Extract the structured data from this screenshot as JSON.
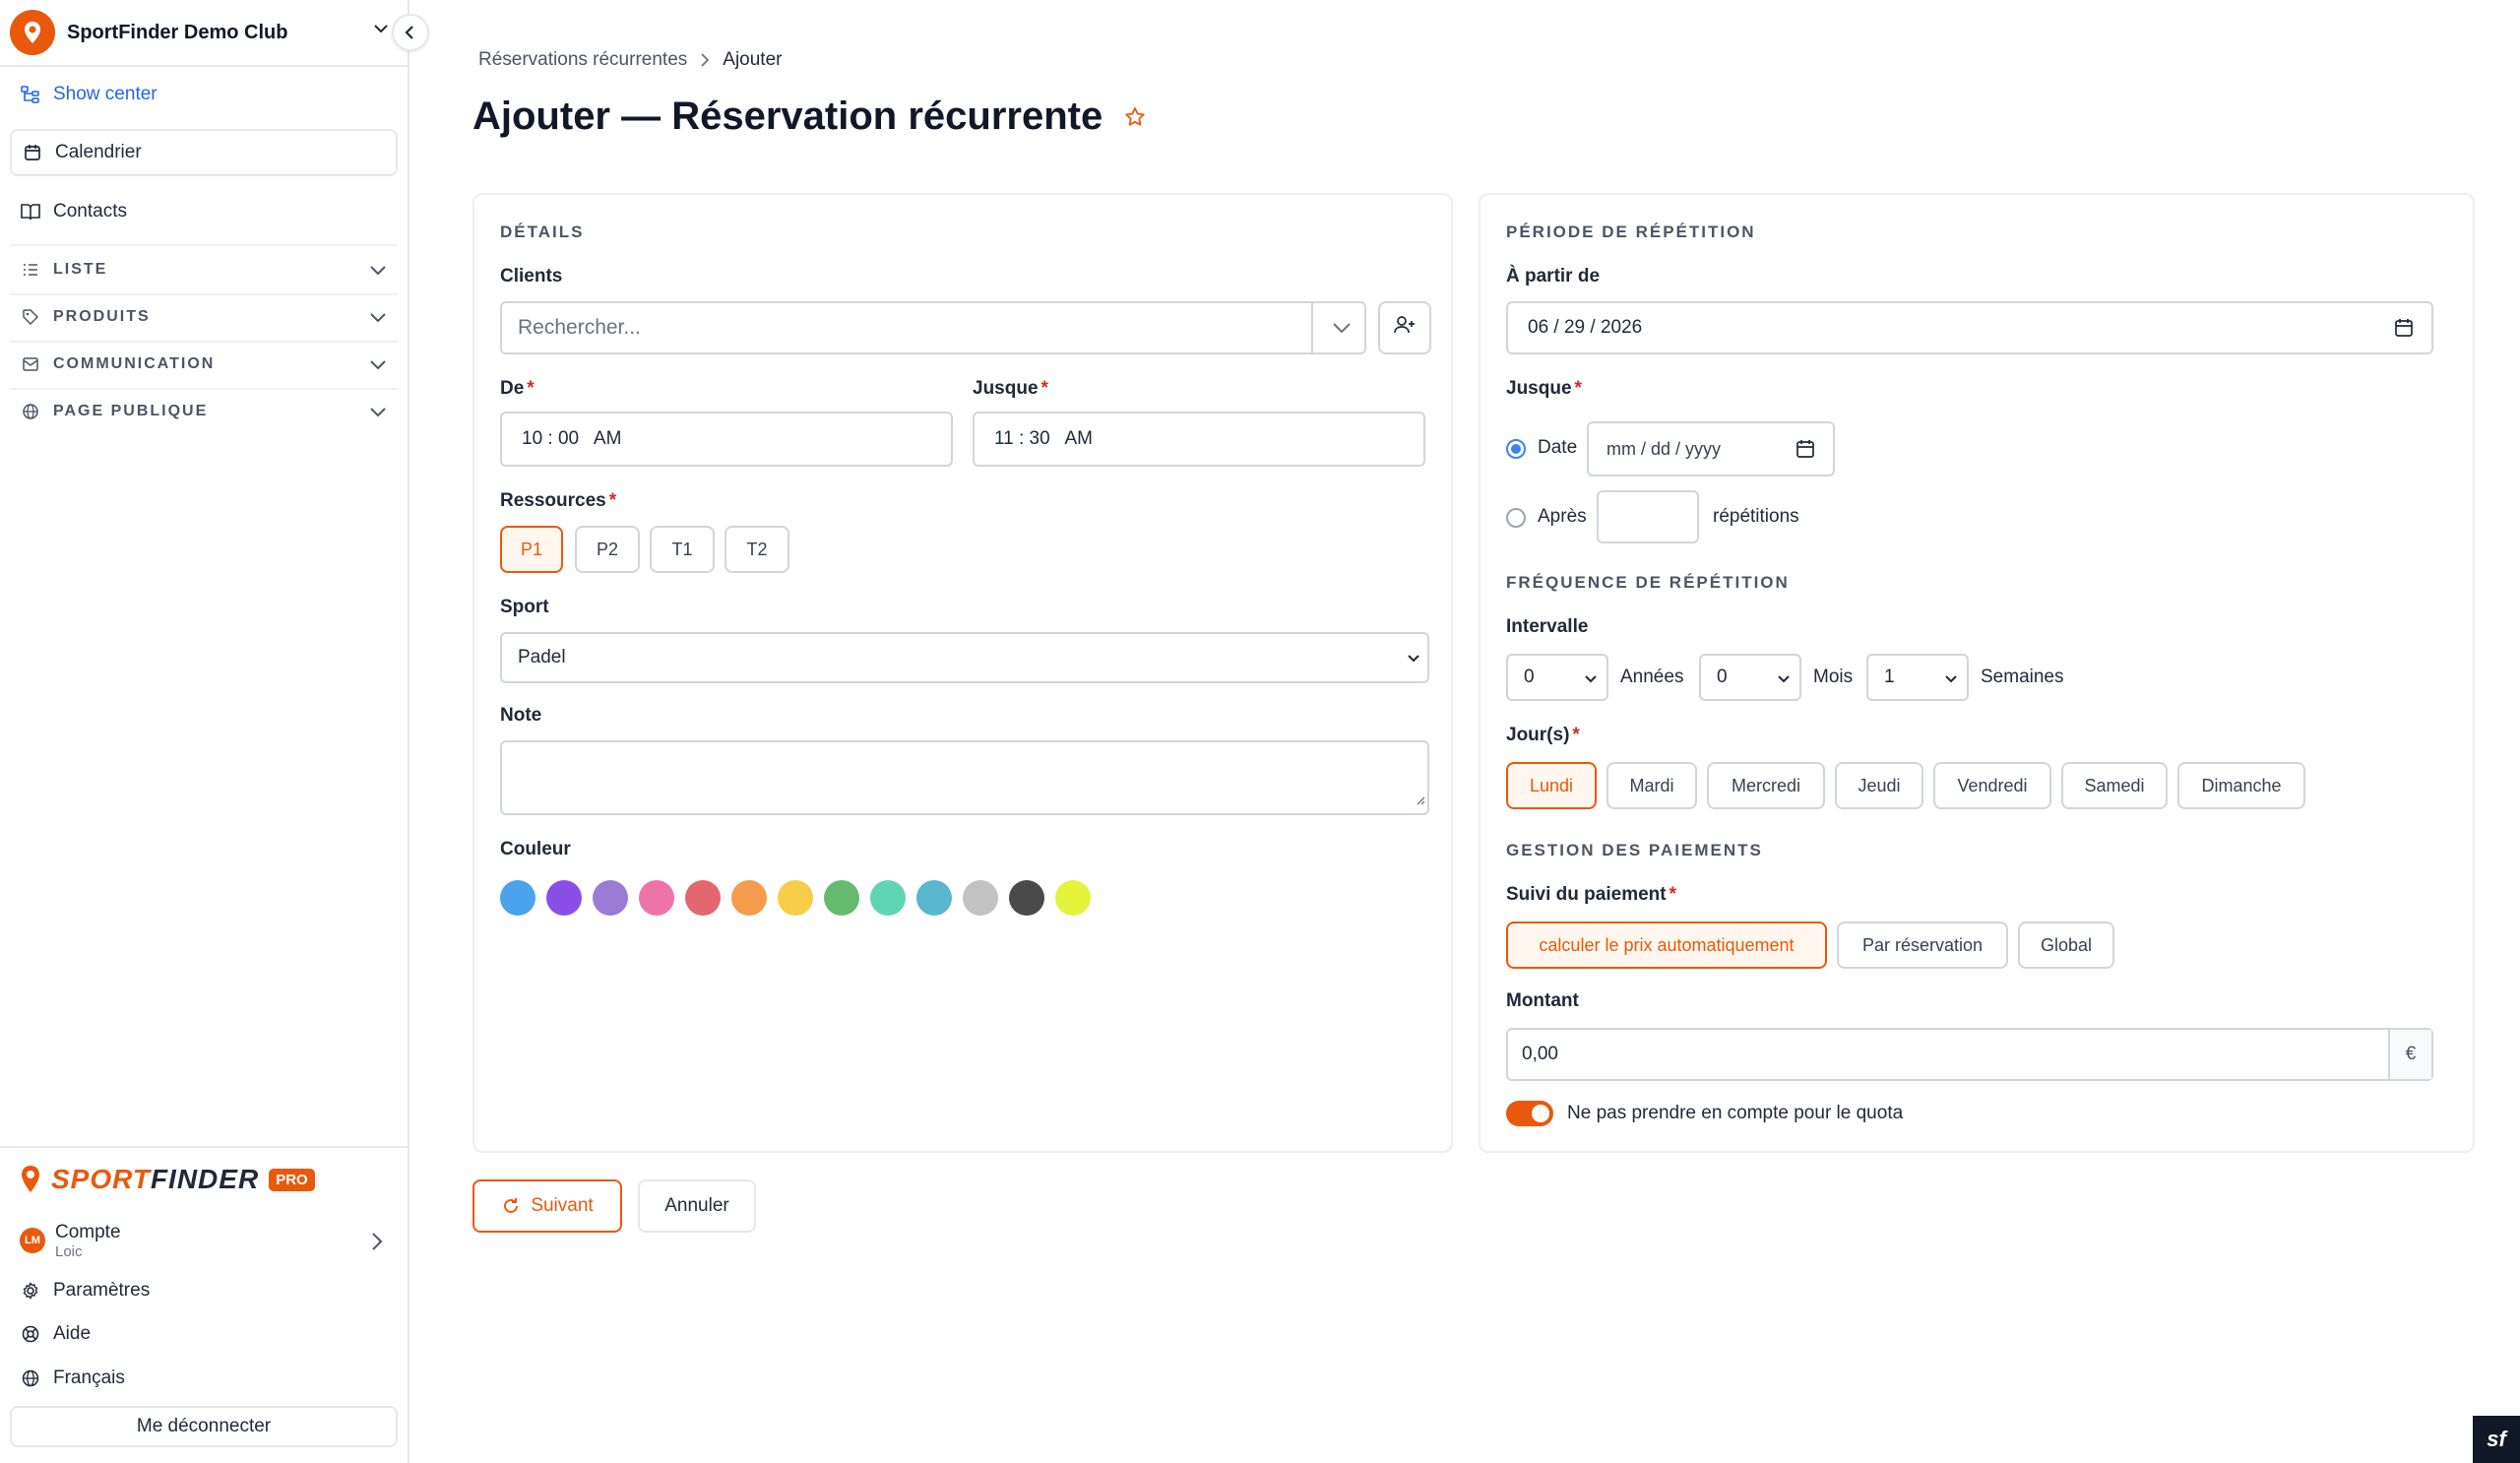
{
  "sidebar": {
    "club_name": "SportFinder Demo Club",
    "show_center": "Show center",
    "calendar": "Calendrier",
    "contacts": "Contacts",
    "sections": [
      "LISTE",
      "PRODUITS",
      "COMMUNICATION",
      "PAGE PUBLIQUE"
    ],
    "brand_sport": "SPORT",
    "brand_finder": "FINDER",
    "brand_badge": "PRO",
    "account_initials": "LM",
    "account_title": "Compte",
    "account_name": "Loic",
    "settings": "Paramètres",
    "help": "Aide",
    "language": "Français",
    "logout": "Me déconnecter"
  },
  "breadcrumb": {
    "parent": "Réservations récurrentes",
    "current": "Ajouter"
  },
  "page_title": "Ajouter — Réservation récurrente",
  "details": {
    "section_title": "DÉTAILS",
    "clients_label": "Clients",
    "clients_placeholder": "Rechercher...",
    "from_label": "De",
    "from_value": "10 : 00   AM",
    "until_label": "Jusque",
    "until_value": "11 : 30   AM",
    "resources_label": "Ressources",
    "resources": [
      "P1",
      "P2",
      "T1",
      "T2"
    ],
    "sport_label": "Sport",
    "sport_value": "Padel",
    "note_label": "Note",
    "color_label": "Couleur",
    "colors": [
      "#4aa3ec",
      "#8b4fe8",
      "#9a7bd6",
      "#ee74a8",
      "#e4666e",
      "#f59b4c",
      "#f7cd47",
      "#66ba6e",
      "#5fd4b2",
      "#58b7cc",
      "#c2c2c2",
      "#4a4a4a",
      "#e4f33b"
    ]
  },
  "period": {
    "section_title": "PÉRIODE DE RÉPÉTITION",
    "from_label": "À partir de",
    "from_value": "06 / 29 / 2026",
    "until_label": "Jusque",
    "date_option": "Date",
    "date_placeholder": "mm / dd / yyyy",
    "after_option": "Après",
    "repetitions_label": "répétitions"
  },
  "frequency": {
    "section_title": "FRÉQUENCE DE RÉPÉTITION",
    "interval_label": "Intervalle",
    "years_value": "0",
    "years_label": "Années",
    "months_value": "0",
    "months_label": "Mois",
    "weeks_value": "1",
    "weeks_label": "Semaines",
    "days_label": "Jour(s)",
    "days": [
      "Lundi",
      "Mardi",
      "Mercredi",
      "Jeudi",
      "Vendredi",
      "Samedi",
      "Dimanche"
    ]
  },
  "payment": {
    "section_title": "GESTION DES PAIEMENTS",
    "tracking_label": "Suivi du paiement",
    "options": [
      "calculer le prix automatiquement",
      "Par réservation",
      "Global"
    ],
    "amount_label": "Montant",
    "amount_value": "0,00",
    "currency": "€",
    "quota_label": "Ne pas prendre en compte pour le quota"
  },
  "actions": {
    "next": "Suivant",
    "cancel": "Annuler"
  },
  "corner_badge": "sf"
}
